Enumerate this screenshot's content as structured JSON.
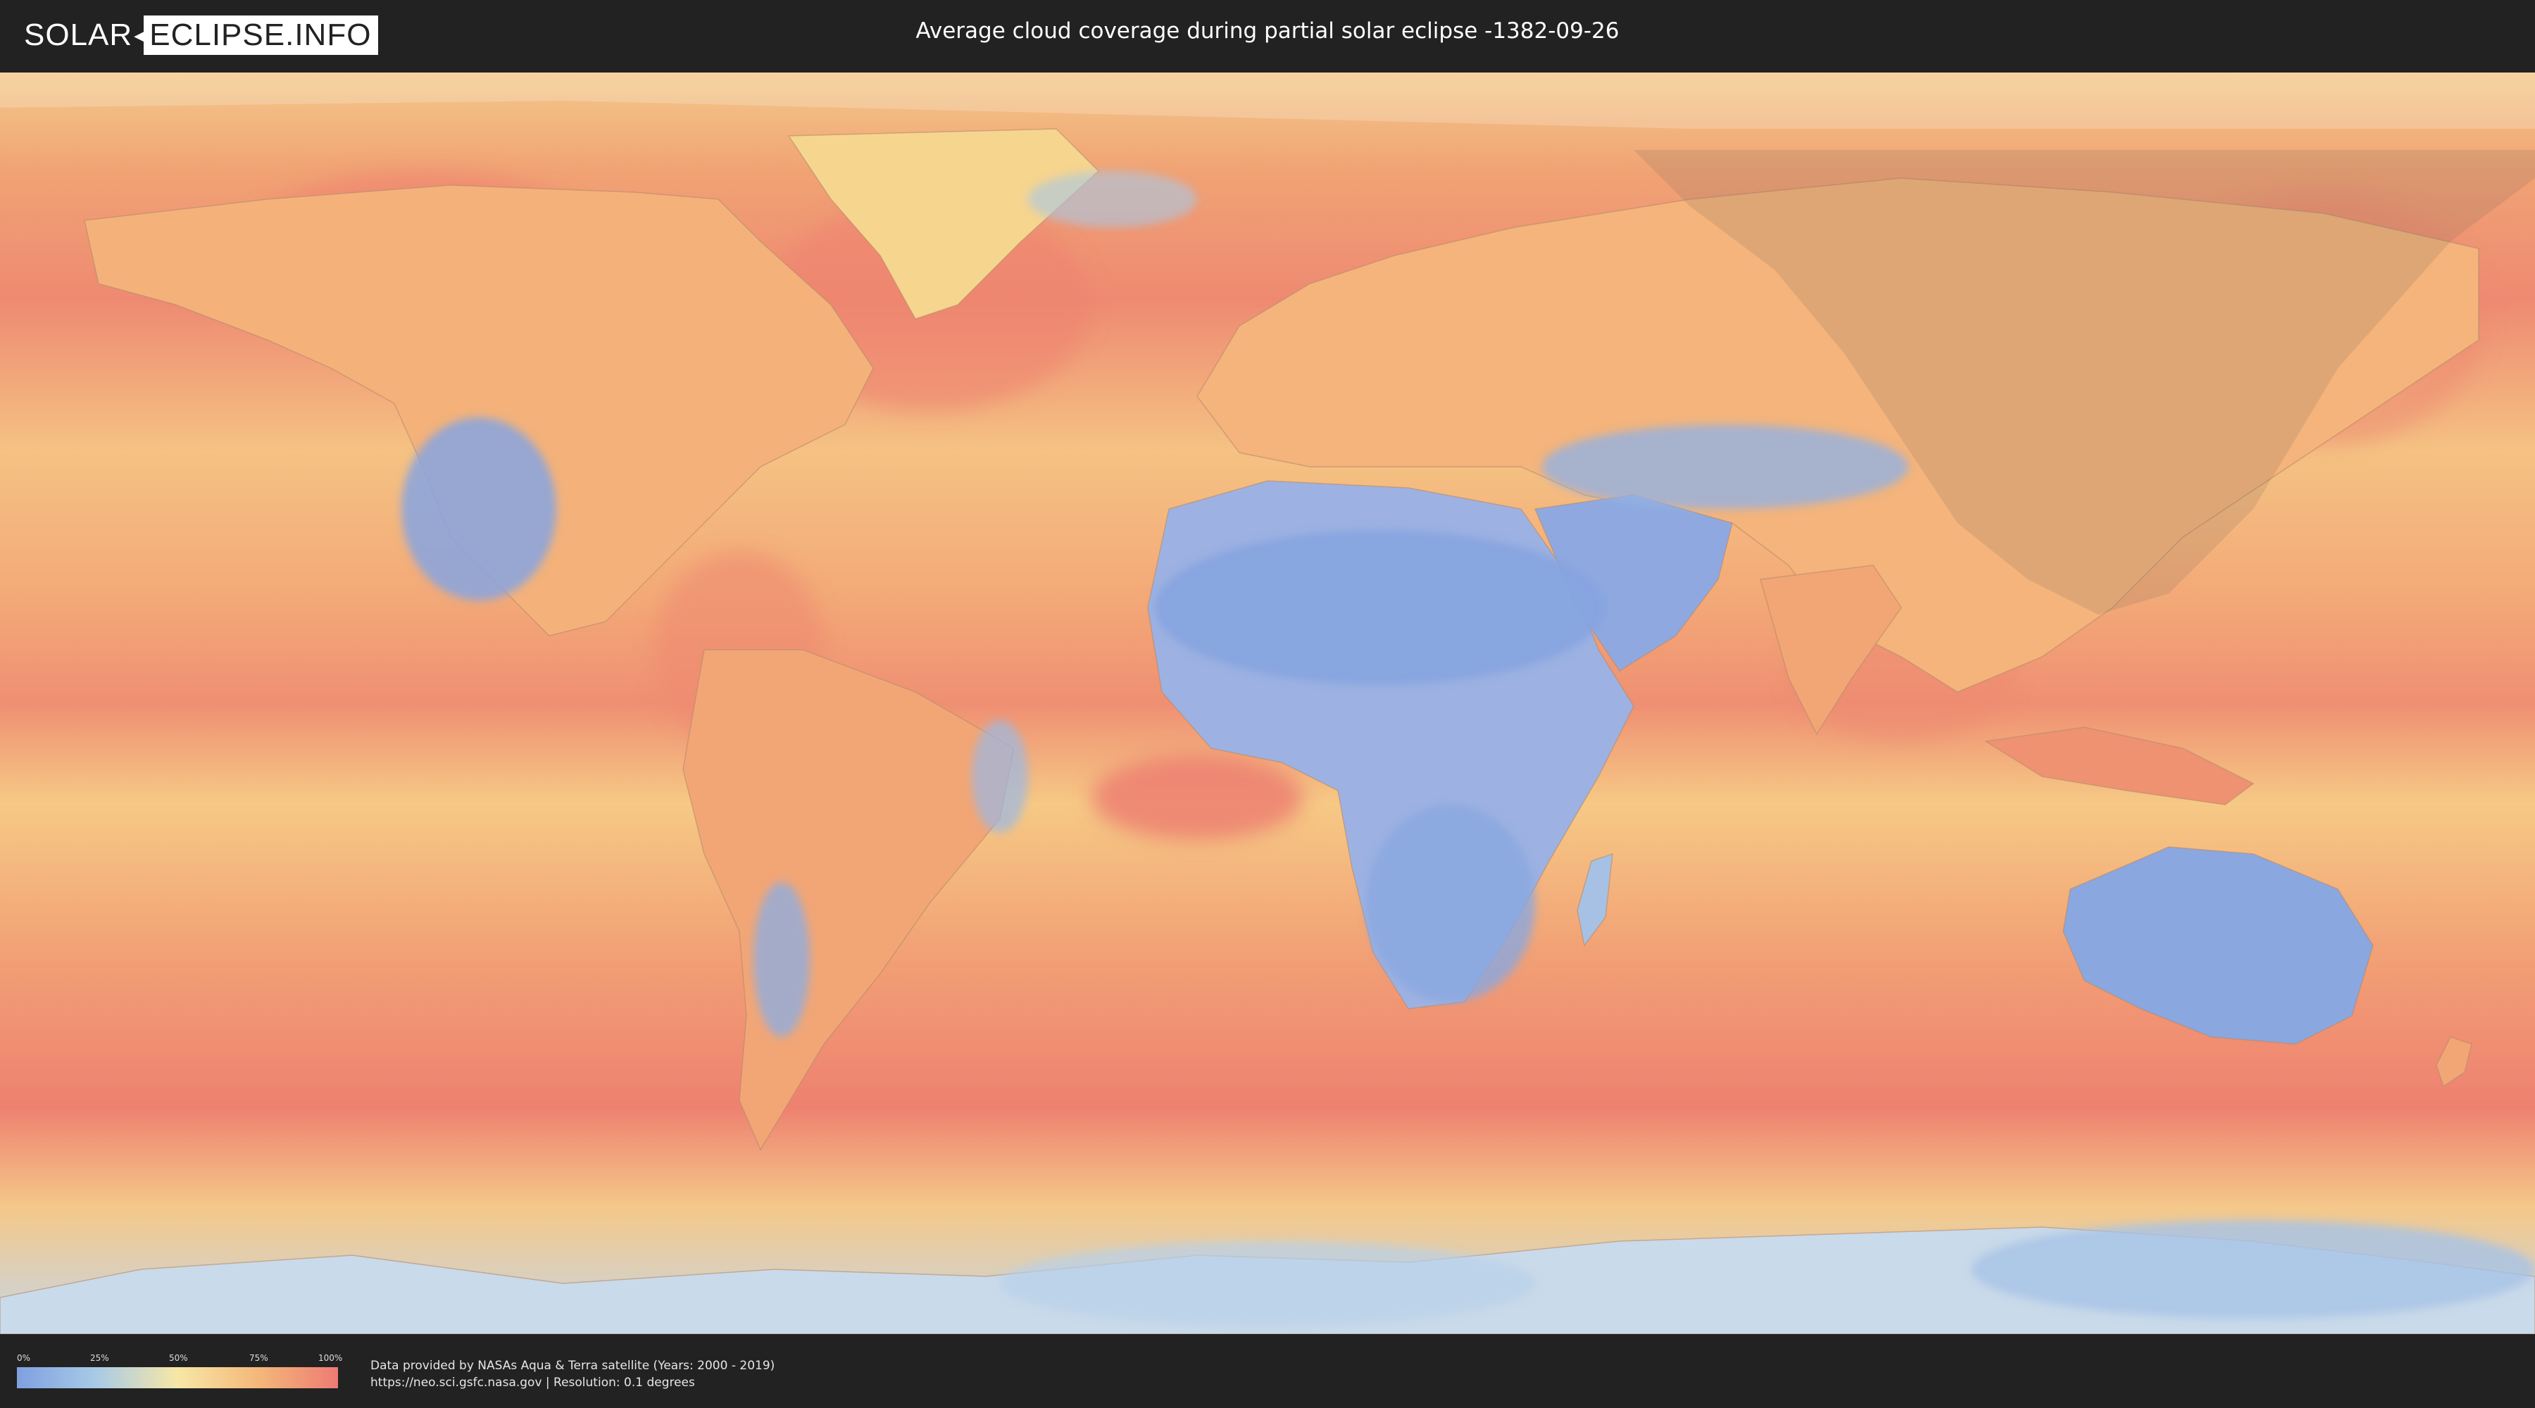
{
  "header": {
    "logo_left": "SOLAR",
    "logo_right": "ECLIPSE.INFO",
    "title": "Average cloud coverage during partial solar eclipse -1382-09-26"
  },
  "map": {
    "colors": {
      "ocean_cloudy": "#ee7b73",
      "mid": "#f4b87a",
      "light": "#f7e7a6",
      "clear": "#7ea0e0",
      "eclipse_shade": "#7a6a5a"
    }
  },
  "legend": {
    "ticks": [
      "0%",
      "25%",
      "50%",
      "75%",
      "100%"
    ],
    "colors": [
      "#7ea0e0",
      "#a9cbe6",
      "#f7e7a6",
      "#f4b87a",
      "#ee7b73"
    ]
  },
  "credits": {
    "line1": "Data provided by NASAs Aqua & Terra satellite (Years: 2000 - 2019)",
    "line2": "https://neo.sci.gsfc.nasa.gov | Resolution: 0.1 degrees"
  }
}
